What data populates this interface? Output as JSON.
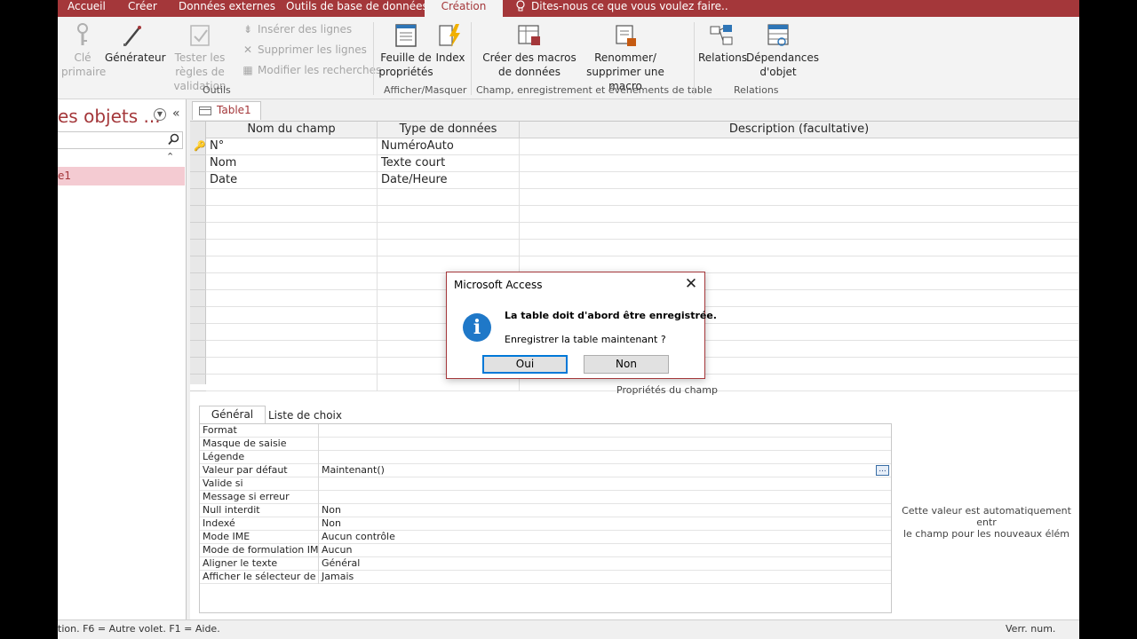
{
  "ribbon": {
    "tabs": [
      "Accueil",
      "Créer",
      "Données externes",
      "Outils de base de données",
      "Création"
    ],
    "active_tab": "Création",
    "tell_me": "Dites-nous ce que vous voulez faire..",
    "buttons": {
      "cle_primaire": "Clé primaire",
      "generateur": "Générateur",
      "tester_regles": "Tester les règles de validation",
      "inserer_lignes": "Insérer des lignes",
      "supprimer_lignes": "Supprimer les lignes",
      "modifier_recherches": "Modifier les recherches",
      "feuille_proprietes": "Feuille de propriétés",
      "index": "Index",
      "creer_macros": "Créer des macros de données",
      "renommer_macro": "Renommer/ supprimer une macro",
      "relations": "Relations",
      "dependances": "Dépendances d'objet"
    },
    "groups": {
      "outils": "Outils",
      "afficher": "Afficher/Masquer",
      "champ": "Champ, enregistrement et événements de table",
      "relations": "Relations"
    }
  },
  "nav": {
    "title": "es objets ...",
    "item": "e1"
  },
  "doc_tab": "Table1",
  "grid": {
    "headers": [
      "Nom du champ",
      "Type de données",
      "Description (facultative)"
    ],
    "rows": [
      {
        "name": "N°",
        "type": "NuméroAuto",
        "desc": ""
      },
      {
        "name": "Nom",
        "type": "Texte court",
        "desc": ""
      },
      {
        "name": "Date",
        "type": "Date/Heure",
        "desc": ""
      }
    ]
  },
  "properties": {
    "title": "Propriétés du champ",
    "tab_general": "Général",
    "tab_list": "Liste de choix",
    "rows": [
      {
        "name": "Format",
        "value": ""
      },
      {
        "name": "Masque de saisie",
        "value": ""
      },
      {
        "name": "Légende",
        "value": ""
      },
      {
        "name": "Valeur par défaut",
        "value": "Maintenant()"
      },
      {
        "name": "Valide si",
        "value": ""
      },
      {
        "name": "Message si erreur",
        "value": ""
      },
      {
        "name": "Null interdit",
        "value": "Non"
      },
      {
        "name": "Indexé",
        "value": "Non"
      },
      {
        "name": "Mode IME",
        "value": "Aucun contrôle"
      },
      {
        "name": "Mode de formulation IME",
        "value": "Aucun"
      },
      {
        "name": "Aligner le texte",
        "value": "Général"
      },
      {
        "name": "Afficher le sélecteur de dates",
        "value": "Jamais"
      }
    ],
    "ellipsis": "...",
    "help_line1": "Cette valeur est automatiquement entr",
    "help_line2": "le champ pour les nouveaux élém"
  },
  "status": {
    "left": "tion. F6 = Autre volet. F1 = Aide.",
    "right": "Verr. num."
  },
  "dialog": {
    "title": "Microsoft Access",
    "message_bold": "La table doit d'abord être enregistrée.",
    "message": "Enregistrer la table maintenant ?",
    "yes": "Oui",
    "no": "Non"
  },
  "colors": {
    "accent": "#a4373a",
    "nav_selected": "#f4cbd2",
    "info_blue": "#1f78c8",
    "focus_blue": "#0078d7"
  }
}
